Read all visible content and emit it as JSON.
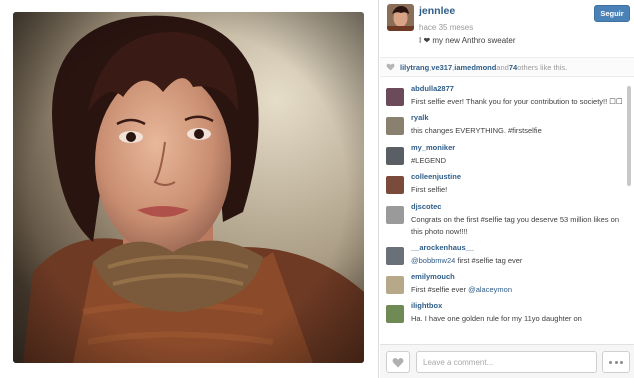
{
  "owner": {
    "username": "jennlee",
    "time": "hace 35 meses",
    "caption": "I ❤ my new Anthro sweater",
    "follow_label": "Seguir"
  },
  "likes": {
    "user1": "lilytrang",
    "sep1": ", ",
    "user2": "ve317",
    "sep2": ", ",
    "user3": "iamedmond",
    "and_text": " and ",
    "count": "74",
    "others_text": " others like this."
  },
  "comments": [
    {
      "user": "abdulla2877",
      "text": "First selfie ever! Thank you for your contribution to society!! ☐☐",
      "avatar_color": "#6b4a5a"
    },
    {
      "user": "ryalk",
      "text": "this changes EVERYTHING. #firstselfie",
      "avatar_color": "#8a8070"
    },
    {
      "user": "my_moniker",
      "text": "#LEGEND",
      "avatar_color": "#5a5f66"
    },
    {
      "user": "colleenjustine",
      "text": "First selfie!",
      "avatar_color": "#7a4a3a"
    },
    {
      "user": "djscotec",
      "text": "Congrats on the first #selfie tag you deserve 53 million likes on this photo now!!!!",
      "avatar_color": "#9a9a9a"
    },
    {
      "user": "__arockenhaus__",
      "mention": "@bobbmw24",
      "text": " first #selfie tag ever",
      "avatar_color": "#6a7078"
    },
    {
      "user": "emilymouch",
      "text_before": "First #selfie ever ",
      "mention": "@alaceymon",
      "avatar_color": "#b7a88a"
    },
    {
      "user": "ilightbox",
      "text": "Ha. I have one golden rule for my 11yo daughter on",
      "avatar_color": "#6f8a55"
    }
  ],
  "footer": {
    "comment_placeholder": "Leave a comment..."
  },
  "icons": {
    "heart": "heart-icon",
    "more": "more-icon"
  },
  "colors": {
    "link": "#2f5d88",
    "button": "#4a82b8"
  }
}
